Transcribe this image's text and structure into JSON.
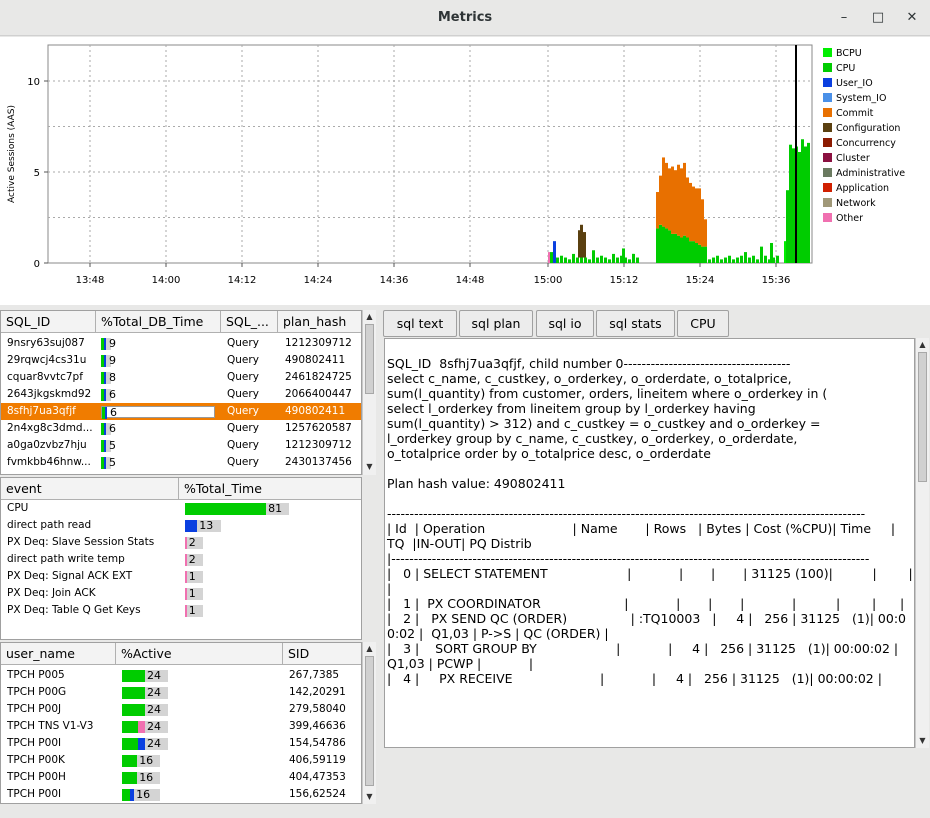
{
  "window": {
    "title": "Metrics",
    "minimize": "–",
    "maximize": "□",
    "close": "✕"
  },
  "chart_data": {
    "type": "area",
    "ylabel": "Active Sessions (AAS)",
    "y_ticks": [
      "0",
      "5",
      "10"
    ],
    "x_ticks": [
      "13:48",
      "14:00",
      "14:12",
      "14:24",
      "14:36",
      "14:48",
      "15:00",
      "15:12",
      "15:24",
      "15:36"
    ],
    "legend": [
      {
        "name": "BCPU",
        "color": "#00ee00"
      },
      {
        "name": "CPU",
        "color": "#00cc00"
      },
      {
        "name": "User_IO",
        "color": "#0a3fe0"
      },
      {
        "name": "System_IO",
        "color": "#4a90e8"
      },
      {
        "name": "Commit",
        "color": "#e87000"
      },
      {
        "name": "Configuration",
        "color": "#5a4010"
      },
      {
        "name": "Concurrency",
        "color": "#8b1a00"
      },
      {
        "name": "Cluster",
        "color": "#8a1040"
      },
      {
        "name": "Administrative",
        "color": "#6a7a60"
      },
      {
        "name": "Application",
        "color": "#d02000"
      },
      {
        "name": "Network",
        "color": "#a09878"
      },
      {
        "name": "Other",
        "color": "#f070b0"
      }
    ],
    "legend_placement": "right"
  },
  "sql_table": {
    "columns": [
      "SQL_ID",
      "%Total_DB_Time",
      "SQL_...",
      "plan_hash"
    ],
    "rows": [
      {
        "id": "9nsry63suj087",
        "pct": "9",
        "type": "Query",
        "hash": "1212309712"
      },
      {
        "id": "29rqwcj4cs31u",
        "pct": "9",
        "type": "Query",
        "hash": "490802411"
      },
      {
        "id": "cquar8vvtc7pf",
        "pct": "8",
        "type": "Query",
        "hash": "2461824725"
      },
      {
        "id": "2643jkgskmd92",
        "pct": "6",
        "type": "Query",
        "hash": "2066400447"
      },
      {
        "id": "8sfhj7ua3qfjf",
        "pct": "6",
        "type": "Query",
        "hash": "490802411"
      },
      {
        "id": "2n4xg8c3dmd...",
        "pct": "6",
        "type": "Query",
        "hash": "1257620587"
      },
      {
        "id": "a0ga0zvbz7hju",
        "pct": "5",
        "type": "Query",
        "hash": "1212309712"
      },
      {
        "id": "fvmkbb46hnw...",
        "pct": "5",
        "type": "Query",
        "hash": "2430137456"
      }
    ]
  },
  "event_table": {
    "columns": [
      "event",
      "%Total_Time"
    ],
    "rows": [
      {
        "name": "CPU",
        "pct": "81"
      },
      {
        "name": "direct path read",
        "pct": "13"
      },
      {
        "name": "PX Deq: Slave Session Stats",
        "pct": "2"
      },
      {
        "name": "direct path write temp",
        "pct": "2"
      },
      {
        "name": "PX Deq: Signal ACK EXT",
        "pct": "1"
      },
      {
        "name": "PX Deq: Join ACK",
        "pct": "1"
      },
      {
        "name": "PX Deq: Table Q Get Keys",
        "pct": "1"
      }
    ]
  },
  "session_table": {
    "columns": [
      "user_name",
      "%Active",
      "SID"
    ],
    "rows": [
      {
        "user": "TPCH P005",
        "pct": "24",
        "sid": "267,7385"
      },
      {
        "user": "TPCH P00G",
        "pct": "24",
        "sid": "142,20291"
      },
      {
        "user": "TPCH P00J",
        "pct": "24",
        "sid": "279,58040"
      },
      {
        "user": "TPCH TNS V1-V3",
        "pct": "24",
        "sid": "399,46636"
      },
      {
        "user": "TPCH P00I",
        "pct": "24",
        "sid": "154,54786"
      },
      {
        "user": "TPCH P00K",
        "pct": "16",
        "sid": "406,59119"
      },
      {
        "user": "TPCH P00H",
        "pct": "16",
        "sid": "404,47353"
      },
      {
        "user": "TPCH P00I",
        "pct": "16",
        "sid": "156,62524"
      }
    ]
  },
  "tabs": [
    "sql text",
    "sql plan",
    "sql io",
    "sql stats",
    "CPU"
  ],
  "sql_text": "SQL_ID  8sfhj7ua3qfjf, child number 0-------------------------------------\nselect c_name, c_custkey, o_orderkey, o_orderdate, o_totalprice,\nsum(l_quantity) from customer, orders, lineitem where o_orderkey in (\nselect l_orderkey from lineitem group by l_orderkey having\nsum(l_quantity) > 312) and c_custkey = o_custkey and o_orderkey =\nl_orderkey group by c_name, c_custkey, o_orderkey, o_orderdate,\no_totalprice order by o_totalprice desc, o_orderdate\n\nPlan hash value: 490802411\n\n----------------------------------------------------------------------------------------------------------\n| Id  | Operation                      | Name       | Rows   | Bytes | Cost (%CPU)| Time     |    TQ  |IN-OUT| PQ Distrib\n|----------------------------------------------------------------------------------------------------------\n|   0 | SELECT STATEMENT                    |            |       |       | 31125 (100)|          |        |      |            \n|   1 |  PX COORDINATOR                     |            |       |       |            |          |        |      |            \n|   2 |   PX SEND QC (ORDER)                | :TQ10003   |     4 |   256 | 31125   (1)| 00:00:02 |  Q1,03 | P->S | QC (ORDER) |\n|   3 |    SORT GROUP BY                    |            |     4 |   256 | 31125   (1)| 00:00:02 |  Q1,03 | PCWP |            |\n|   4 |     PX RECEIVE                      |            |     4 |   256 | 31125   (1)| 00:00:02 |"
}
